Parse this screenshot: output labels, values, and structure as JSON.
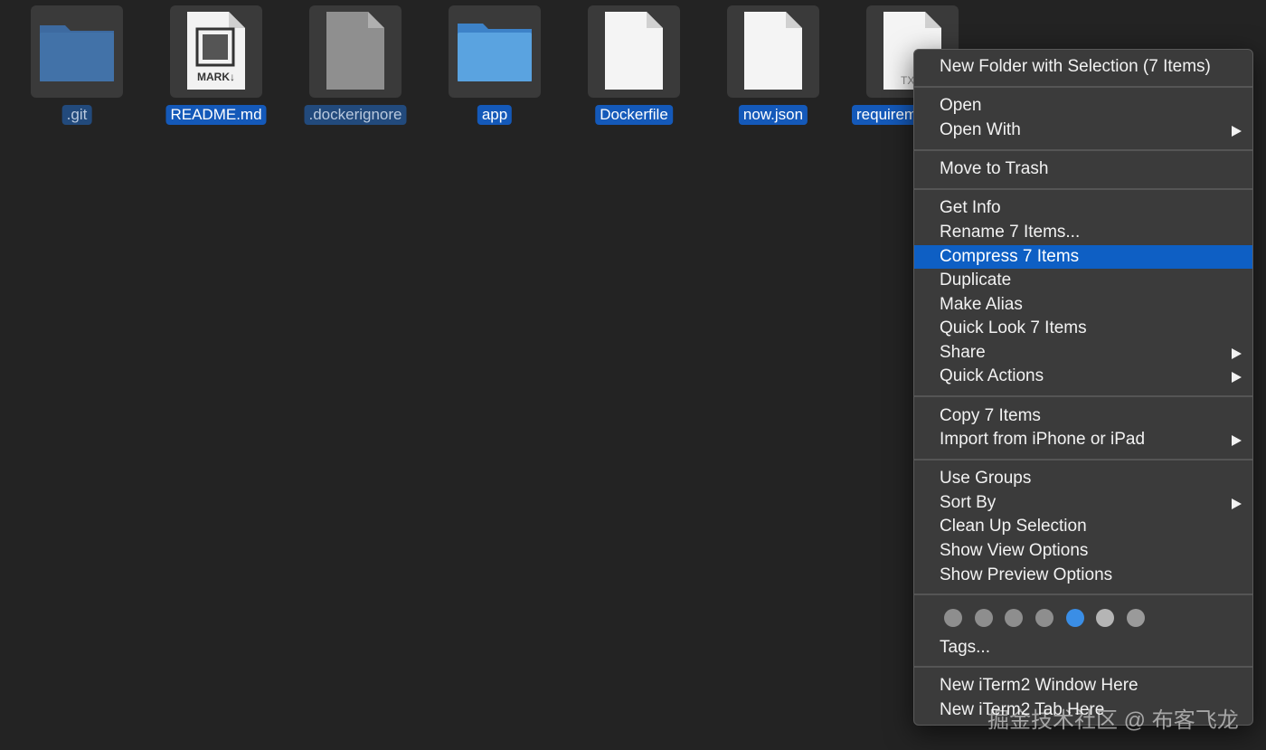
{
  "files": [
    {
      "name": ".git",
      "kind": "folder-dim"
    },
    {
      "name": "README.md",
      "kind": "markdown",
      "badge": "MARK↓"
    },
    {
      "name": ".dockerignore",
      "kind": "doc-dim"
    },
    {
      "name": "app",
      "kind": "folder"
    },
    {
      "name": "Dockerfile",
      "kind": "doc"
    },
    {
      "name": "now.json",
      "kind": "doc"
    },
    {
      "name": "requirem",
      "kind": "txt",
      "badge": "TX"
    }
  ],
  "context_menu": {
    "new_folder": "New Folder with Selection (7 Items)",
    "open": "Open",
    "open_with": "Open With",
    "move_to_trash": "Move to Trash",
    "get_info": "Get Info",
    "rename": "Rename 7 Items...",
    "compress": "Compress 7 Items",
    "duplicate": "Duplicate",
    "make_alias": "Make Alias",
    "quick_look": "Quick Look 7 Items",
    "share": "Share",
    "quick_actions": "Quick Actions",
    "copy": "Copy 7 Items",
    "import": "Import from iPhone or iPad",
    "use_groups": "Use Groups",
    "sort_by": "Sort By",
    "clean_up": "Clean Up Selection",
    "show_view_options": "Show View Options",
    "show_preview_options": "Show Preview Options",
    "tags": "Tags...",
    "iterm_window": "New iTerm2 Window Here",
    "iterm_tab": "New iTerm2 Tab Here",
    "highlighted_item": "Compress 7 Items"
  },
  "tag_colors": [
    "#8e8e8e",
    "#8e8e8e",
    "#8e8e8e",
    "#8e8e8e",
    "#3a8ee6",
    "#b5b5b5",
    "#9a9a9a"
  ],
  "colors": {
    "selection": "#1459b9",
    "menu_highlight": "#0e5fc4",
    "folder": "#4f9ad8"
  },
  "watermark": "掘金技术社区 @ 布客飞龙"
}
